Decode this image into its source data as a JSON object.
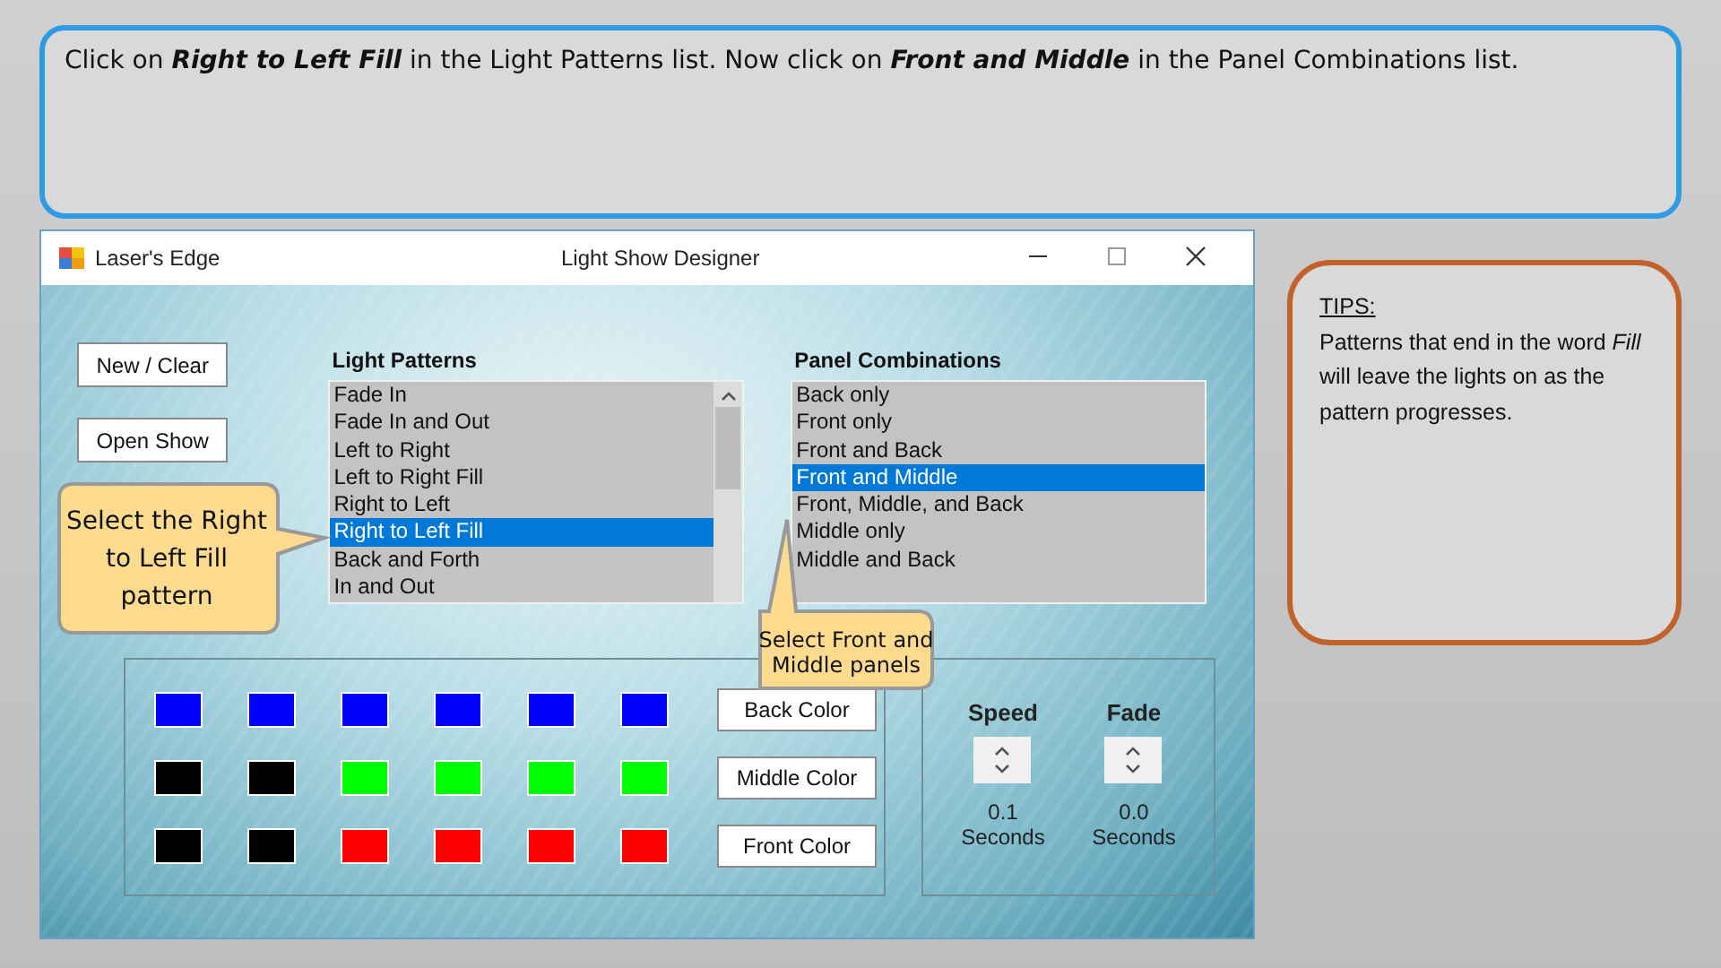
{
  "instruction": "Click on **Right to Left Fill** in the Light Patterns list.  Now click on **Front and Middle** in the Panel Combinations list.",
  "window": {
    "app_name": "Laser's Edge",
    "title": "Light Show Designer"
  },
  "buttons": [
    {
      "label": "New / Clear"
    },
    {
      "label": "Open Show"
    }
  ],
  "light_patterns": {
    "label": "Light Patterns",
    "items": [
      {
        "text": "Fade In",
        "selected": false
      },
      {
        "text": "Fade In and Out",
        "selected": false
      },
      {
        "text": "Left to Right",
        "selected": false
      },
      {
        "text": "Left to Right Fill",
        "selected": false
      },
      {
        "text": "Right to Left",
        "selected": false
      },
      {
        "text": "Right to Left Fill",
        "selected": true
      },
      {
        "text": "Back and Forth",
        "selected": false
      },
      {
        "text": "In and Out",
        "selected": false
      }
    ],
    "callout": "Select the Right to Left Fill pattern"
  },
  "panel_combinations": {
    "label": "Panel Combinations",
    "items": [
      {
        "text": "Back only",
        "selected": false
      },
      {
        "text": "Front only",
        "selected": false
      },
      {
        "text": "Front and Back",
        "selected": false
      },
      {
        "text": "Front and Middle",
        "selected": true
      },
      {
        "text": "Front, Middle, and Back",
        "selected": false
      },
      {
        "text": "Middle only",
        "selected": false
      },
      {
        "text": "Middle and Back",
        "selected": false
      }
    ],
    "callout": "Select Front and Middle panels"
  },
  "color_rows": [
    {
      "button": "Back Color",
      "swatches": [
        {
          "color": "#0000ff"
        },
        {
          "color": "#0000ff"
        },
        {
          "color": "#0000ff"
        },
        {
          "color": "#0000ff"
        },
        {
          "color": "#0000ff"
        },
        {
          "color": "#0000ff"
        }
      ]
    },
    {
      "button": "Middle Color",
      "swatches": [
        {
          "color": "#000000"
        },
        {
          "color": "#000000"
        },
        {
          "color": "#00ff00"
        },
        {
          "color": "#00ff00"
        },
        {
          "color": "#00ff00"
        },
        {
          "color": "#00ff00"
        }
      ]
    },
    {
      "button": "Front Color",
      "swatches": [
        {
          "color": "#000000"
        },
        {
          "color": "#000000"
        },
        {
          "color": "#ff0000"
        },
        {
          "color": "#ff0000"
        },
        {
          "color": "#ff0000"
        },
        {
          "color": "#ff0000"
        }
      ]
    }
  ],
  "timers": [
    {
      "label": "Speed",
      "value": "0.1",
      "unit": "Seconds"
    },
    {
      "label": "Fade",
      "value": "0.0",
      "unit": "Seconds"
    }
  ],
  "tips": {
    "title": "TIPS:",
    "text": "Patterns that end in the word *Fill* will leave the lights on as the pattern progresses."
  }
}
